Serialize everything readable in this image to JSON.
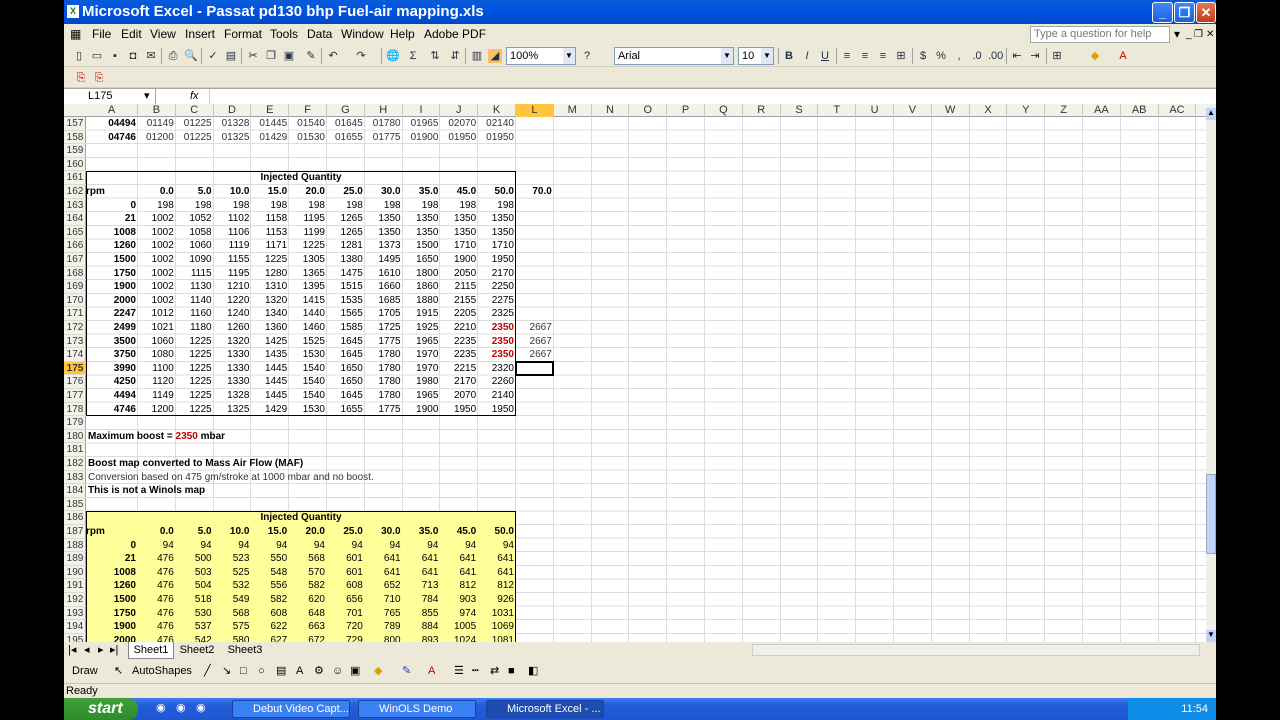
{
  "window": {
    "title": "Microsoft Excel - Passat pd130 bhp Fuel-air mapping.xls"
  },
  "menu": {
    "items": [
      "File",
      "Edit",
      "View",
      "Insert",
      "Format",
      "Tools",
      "Data",
      "Window",
      "Help",
      "Adobe PDF"
    ],
    "question_placeholder": "Type a question for help"
  },
  "toolbar": {
    "zoom": "100%",
    "font": "Arial",
    "size": "10"
  },
  "formula": {
    "namebox": "L175",
    "fx": "fx"
  },
  "columns": [
    "A",
    "B",
    "C",
    "D",
    "E",
    "F",
    "G",
    "H",
    "I",
    "J",
    "K",
    "L",
    "M",
    "N",
    "O",
    "P",
    "Q",
    "R",
    "S",
    "T",
    "U",
    "V",
    "W",
    "X",
    "Y",
    "Z",
    "AA",
    "AB",
    "AC"
  ],
  "rows": [
    "157",
    "158",
    "159",
    "160",
    "161",
    "162",
    "163",
    "164",
    "165",
    "166",
    "167",
    "168",
    "169",
    "170",
    "171",
    "172",
    "173",
    "174",
    "175",
    "176",
    "177",
    "178",
    "179",
    "180",
    "181",
    "182",
    "183",
    "184",
    "185",
    "186",
    "187",
    "188",
    "189",
    "190",
    "191",
    "192",
    "193",
    "194",
    "195"
  ],
  "sheet": {
    "r157": [
      "04494",
      "01149",
      "01225",
      "01328",
      "01445",
      "01540",
      "01645",
      "01780",
      "01965",
      "02070",
      "02140"
    ],
    "r158": [
      "04746",
      "01200",
      "01225",
      "01325",
      "01429",
      "01530",
      "01655",
      "01775",
      "01900",
      "01950",
      "01950"
    ],
    "iq_title": "Injected Quantity",
    "header_rpm": "rpm",
    "header_vals": [
      "0.0",
      "5.0",
      "10.0",
      "15.0",
      "20.0",
      "25.0",
      "30.0",
      "35.0",
      "45.0",
      "50.0"
    ],
    "header_extra": "70.0",
    "boost": [
      [
        "0",
        "198",
        "198",
        "198",
        "198",
        "198",
        "198",
        "198",
        "198",
        "198",
        "198"
      ],
      [
        "21",
        "1002",
        "1052",
        "1102",
        "1158",
        "1195",
        "1265",
        "1350",
        "1350",
        "1350",
        "1350"
      ],
      [
        "1008",
        "1002",
        "1058",
        "1106",
        "1153",
        "1199",
        "1265",
        "1350",
        "1350",
        "1350",
        "1350"
      ],
      [
        "1260",
        "1002",
        "1060",
        "1119",
        "1171",
        "1225",
        "1281",
        "1373",
        "1500",
        "1710",
        "1710"
      ],
      [
        "1500",
        "1002",
        "1090",
        "1155",
        "1225",
        "1305",
        "1380",
        "1495",
        "1650",
        "1900",
        "1950"
      ],
      [
        "1750",
        "1002",
        "1115",
        "1195",
        "1280",
        "1365",
        "1475",
        "1610",
        "1800",
        "2050",
        "2170"
      ],
      [
        "1900",
        "1002",
        "1130",
        "1210",
        "1310",
        "1395",
        "1515",
        "1660",
        "1860",
        "2115",
        "2250"
      ],
      [
        "2000",
        "1002",
        "1140",
        "1220",
        "1320",
        "1415",
        "1535",
        "1685",
        "1880",
        "2155",
        "2275"
      ],
      [
        "2247",
        "1012",
        "1160",
        "1240",
        "1340",
        "1440",
        "1565",
        "1705",
        "1915",
        "2205",
        "2325"
      ],
      [
        "2499",
        "1021",
        "1180",
        "1260",
        "1360",
        "1460",
        "1585",
        "1725",
        "1925",
        "2210",
        "2350"
      ],
      [
        "3500",
        "1060",
        "1225",
        "1320",
        "1425",
        "1525",
        "1645",
        "1775",
        "1965",
        "2235",
        "2350"
      ],
      [
        "3750",
        "1080",
        "1225",
        "1330",
        "1435",
        "1530",
        "1645",
        "1780",
        "1970",
        "2235",
        "2350"
      ],
      [
        "3990",
        "1100",
        "1225",
        "1330",
        "1445",
        "1540",
        "1650",
        "1780",
        "1970",
        "2215",
        "2320"
      ],
      [
        "4250",
        "1120",
        "1225",
        "1330",
        "1445",
        "1540",
        "1650",
        "1780",
        "1980",
        "2170",
        "2260"
      ],
      [
        "4494",
        "1149",
        "1225",
        "1328",
        "1445",
        "1540",
        "1645",
        "1780",
        "1965",
        "2070",
        "2140"
      ],
      [
        "4746",
        "1200",
        "1225",
        "1325",
        "1429",
        "1530",
        "1655",
        "1775",
        "1900",
        "1950",
        "1950"
      ]
    ],
    "l_vals": {
      "r172": "2667",
      "r173": "2667",
      "r174": "2667"
    },
    "max_boost_label": "Maximum boost =",
    "max_boost_val": "2350",
    "max_boost_unit": "mbar",
    "maf_title": "Boost map converted to Mass Air Flow (MAF)",
    "maf_note": "Conversion based on 475 gm/stroke at 1000 mbar and no boost.",
    "maf_note2": "This is not a Winols map",
    "maf": [
      [
        "0",
        "94",
        "94",
        "94",
        "94",
        "94",
        "94",
        "94",
        "94",
        "94",
        "94"
      ],
      [
        "21",
        "476",
        "500",
        "523",
        "550",
        "568",
        "601",
        "641",
        "641",
        "641",
        "641"
      ],
      [
        "1008",
        "476",
        "503",
        "525",
        "548",
        "570",
        "601",
        "641",
        "641",
        "641",
        "641"
      ],
      [
        "1260",
        "476",
        "504",
        "532",
        "556",
        "582",
        "608",
        "652",
        "713",
        "812",
        "812"
      ],
      [
        "1500",
        "476",
        "518",
        "549",
        "582",
        "620",
        "656",
        "710",
        "784",
        "903",
        "926"
      ],
      [
        "1750",
        "476",
        "530",
        "568",
        "608",
        "648",
        "701",
        "765",
        "855",
        "974",
        "1031"
      ],
      [
        "1900",
        "476",
        "537",
        "575",
        "622",
        "663",
        "720",
        "789",
        "884",
        "1005",
        "1069"
      ],
      [
        "2000",
        "476",
        "542",
        "580",
        "627",
        "672",
        "729",
        "800",
        "893",
        "1024",
        "1081"
      ]
    ]
  },
  "tabs": [
    "Sheet1",
    "Sheet2",
    "Sheet3"
  ],
  "drawbar": {
    "draw": "Draw",
    "autoshapes": "AutoShapes"
  },
  "status": "Ready",
  "taskbar": {
    "start": "start",
    "items": [
      "Debut Video Capt...",
      "WinOLS Demo",
      "Microsoft Excel - ..."
    ],
    "clock": "11:54"
  }
}
